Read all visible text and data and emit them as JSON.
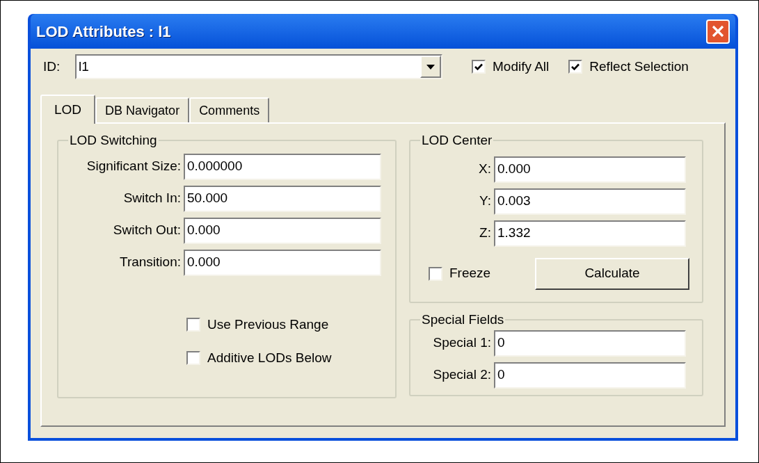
{
  "window": {
    "title": "LOD Attributes : l1"
  },
  "id_field": {
    "label": "ID:",
    "value": "l1"
  },
  "options": [
    {
      "label": "Modify All",
      "checked": true
    },
    {
      "label": "Reflect Selection",
      "checked": true
    }
  ],
  "tabs": [
    {
      "label": "LOD",
      "selected": true
    },
    {
      "label": "DB Navigator",
      "selected": false
    },
    {
      "label": "Comments",
      "selected": false
    }
  ],
  "lod_switching": {
    "title": "LOD Switching",
    "fields": [
      {
        "label": "Significant Size:",
        "value": "0.000000"
      },
      {
        "label": "Switch In:",
        "value": "50.000"
      },
      {
        "label": "Switch Out:",
        "value": "0.000"
      },
      {
        "label": "Transition:",
        "value": "0.000"
      }
    ],
    "checkboxes": [
      {
        "label": "Use Previous Range",
        "checked": false
      },
      {
        "label": "Additive LODs Below",
        "checked": false
      }
    ]
  },
  "lod_center": {
    "title": "LOD Center",
    "fields": [
      {
        "label": "X:",
        "value": "0.000"
      },
      {
        "label": "Y:",
        "value": "0.003"
      },
      {
        "label": "Z:",
        "value": "1.332"
      }
    ],
    "freeze": {
      "label": "Freeze",
      "checked": false
    },
    "button": "Calculate"
  },
  "special_fields": {
    "title": "Special Fields",
    "fields": [
      {
        "label": "Special 1:",
        "value": "0"
      },
      {
        "label": "Special 2:",
        "value": "0"
      }
    ]
  }
}
